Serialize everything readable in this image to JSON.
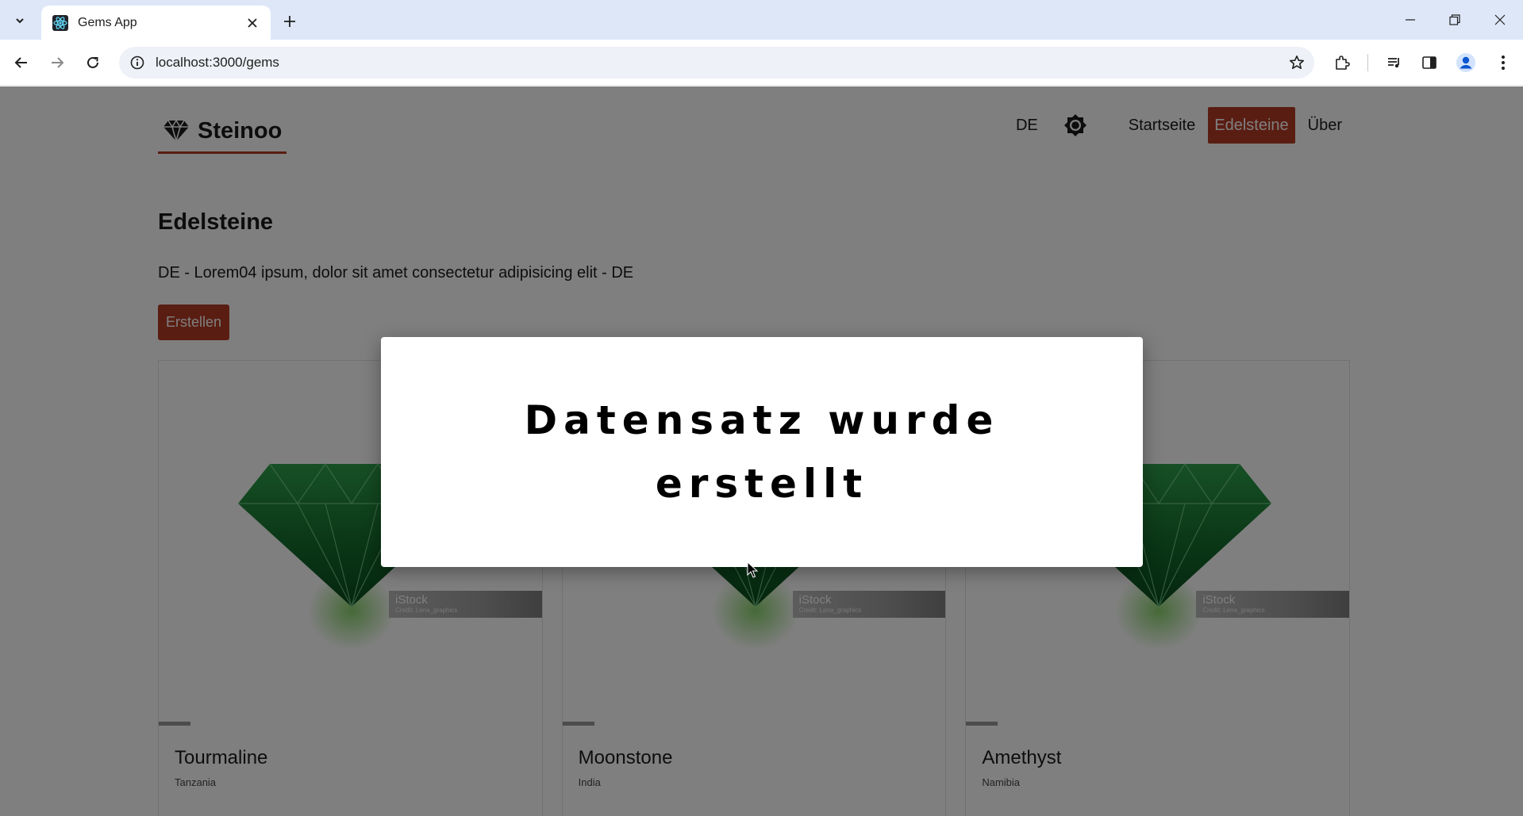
{
  "browser": {
    "tab_title": "Gems App",
    "url": "localhost:3000/gems"
  },
  "navbar": {
    "brand": "Steinoo",
    "lang": "DE",
    "links": [
      "Startseite",
      "Edelsteine",
      "Über"
    ],
    "active_link": "Edelsteine",
    "accent_color": "#b53a25"
  },
  "main": {
    "title": "Edelsteine",
    "description": "DE - Lorem04 ipsum, dolor sit amet consectetur adipisicing elit - DE",
    "create_label": "Erstellen"
  },
  "cards": [
    {
      "name": "Tourmaline",
      "origin": "Tanzania",
      "watermark": "iStock",
      "credit": "Credit: Lena_graphics"
    },
    {
      "name": "Moonstone",
      "origin": "India",
      "watermark": "iStock",
      "credit": "Credit: Lena_graphics"
    },
    {
      "name": "Amethyst",
      "origin": "Namibia",
      "watermark": "iStock",
      "credit": "Credit: Lena_graphics"
    }
  ],
  "modal": {
    "message": "Datensatz wurde erstellt"
  },
  "icons": {
    "tab_favicon": "react-icon",
    "brand_logo": "diamond-icon",
    "theme_toggle": "sun-icon"
  }
}
